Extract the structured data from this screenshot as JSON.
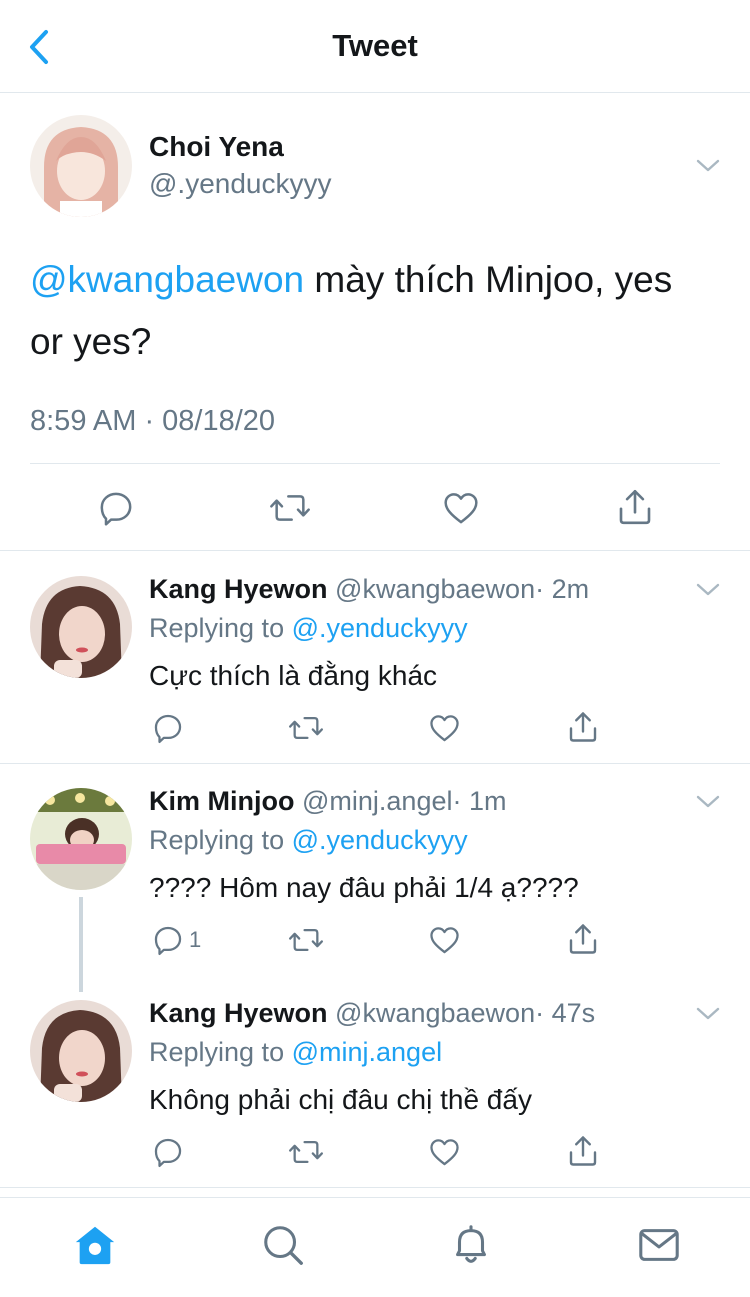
{
  "header": {
    "title": "Tweet"
  },
  "main_tweet": {
    "name": "Choi Yena",
    "handle": "@.yenduckyyy",
    "mention": "@kwangbaewon",
    "text_line1": " mày thích Minjoo, yes",
    "text_line2": "or yes?",
    "timestamp": "8:59 AM · 08/18/20"
  },
  "replies": [
    {
      "name": "Kang Hyewon",
      "handle": "@kwangbaewon",
      "time": "· 2m",
      "replying_label": "Replying to",
      "replying_to": "@.yenduckyyy",
      "text": "Cực thích là đằng khác",
      "reply_count": ""
    },
    {
      "name": "Kim Minjoo",
      "handle": "@minj.angel",
      "time": "· 1m",
      "replying_label": "Replying to",
      "replying_to": "@.yenduckyyy",
      "text": "???? Hôm nay đâu phải 1/4 ạ????",
      "reply_count": "1"
    },
    {
      "name": "Kang Hyewon",
      "handle": "@kwangbaewon",
      "time": "· 47s",
      "replying_label": "Replying to",
      "replying_to": "@minj.angel",
      "text": "Không phải chị đâu chị thề đấy",
      "reply_count": ""
    }
  ],
  "icons": {
    "back": "chevron-left-icon",
    "more": "chevron-down-icon",
    "reply": "comment-icon",
    "retweet": "retweet-icon",
    "like": "heart-icon",
    "share": "share-icon",
    "tabs": [
      "home-icon",
      "search-icon",
      "bell-icon",
      "mail-icon"
    ]
  },
  "colors": {
    "accent": "#1da1f2",
    "icon": "#657786",
    "text": "#14171a",
    "divider": "#e1e8ed"
  }
}
